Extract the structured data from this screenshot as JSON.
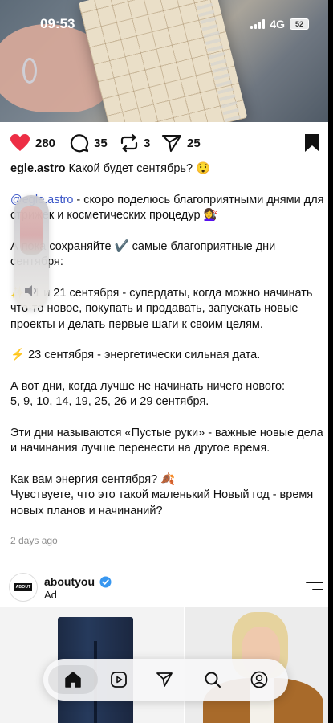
{
  "status_bar": {
    "time": "09:53",
    "network": "4G",
    "battery": "52"
  },
  "post": {
    "likes": "280",
    "comments": "35",
    "reposts": "3",
    "shares": "25",
    "username": "egle.astro",
    "title_text": "Какой будет сентябрь? 😯",
    "mention": "@egle.astro",
    "intro": " - скоро поделюсь благоприятными днями для стрижек и косметических процедур 💇‍♀️",
    "save_line": "А пока сохраняйте ✔️ самые благоприятные дни сентября:",
    "superdates": "✨ 11 и 21 сентября - супердаты, когда можно начинать что-то новое, покупать и продавать, запускать новые проекты и делать первые шаги к своим целям.",
    "energy_date": "⚡ 23 сентября - энергетически сильная дата.",
    "bad_days_1": "А вот дни, когда лучше не начинать ничего нового:",
    "bad_days_2": "5, 9, 10, 14, 19, 25, 26 и 29 сентября.",
    "empty_hands": "Эти дни называются «Пустые руки» - важные новые дела и начинания лучше перенести на другое время.",
    "question_1": "Как вам энергия сентября? 🍂",
    "question_2": "Чувствуете, что это такой маленький Новый год - время новых планов и начинаний?",
    "timestamp": "2 days ago"
  },
  "ad": {
    "account": "aboutyou",
    "label": "Ad",
    "logo_text": "ABOUT YOU"
  },
  "nav": {
    "items": [
      "home-icon",
      "reels-icon",
      "direct-icon",
      "search-icon",
      "profile-icon"
    ]
  },
  "colors": {
    "heart": "#ed2e45",
    "mention": "#3a56c7",
    "verified": "#3897f0"
  }
}
